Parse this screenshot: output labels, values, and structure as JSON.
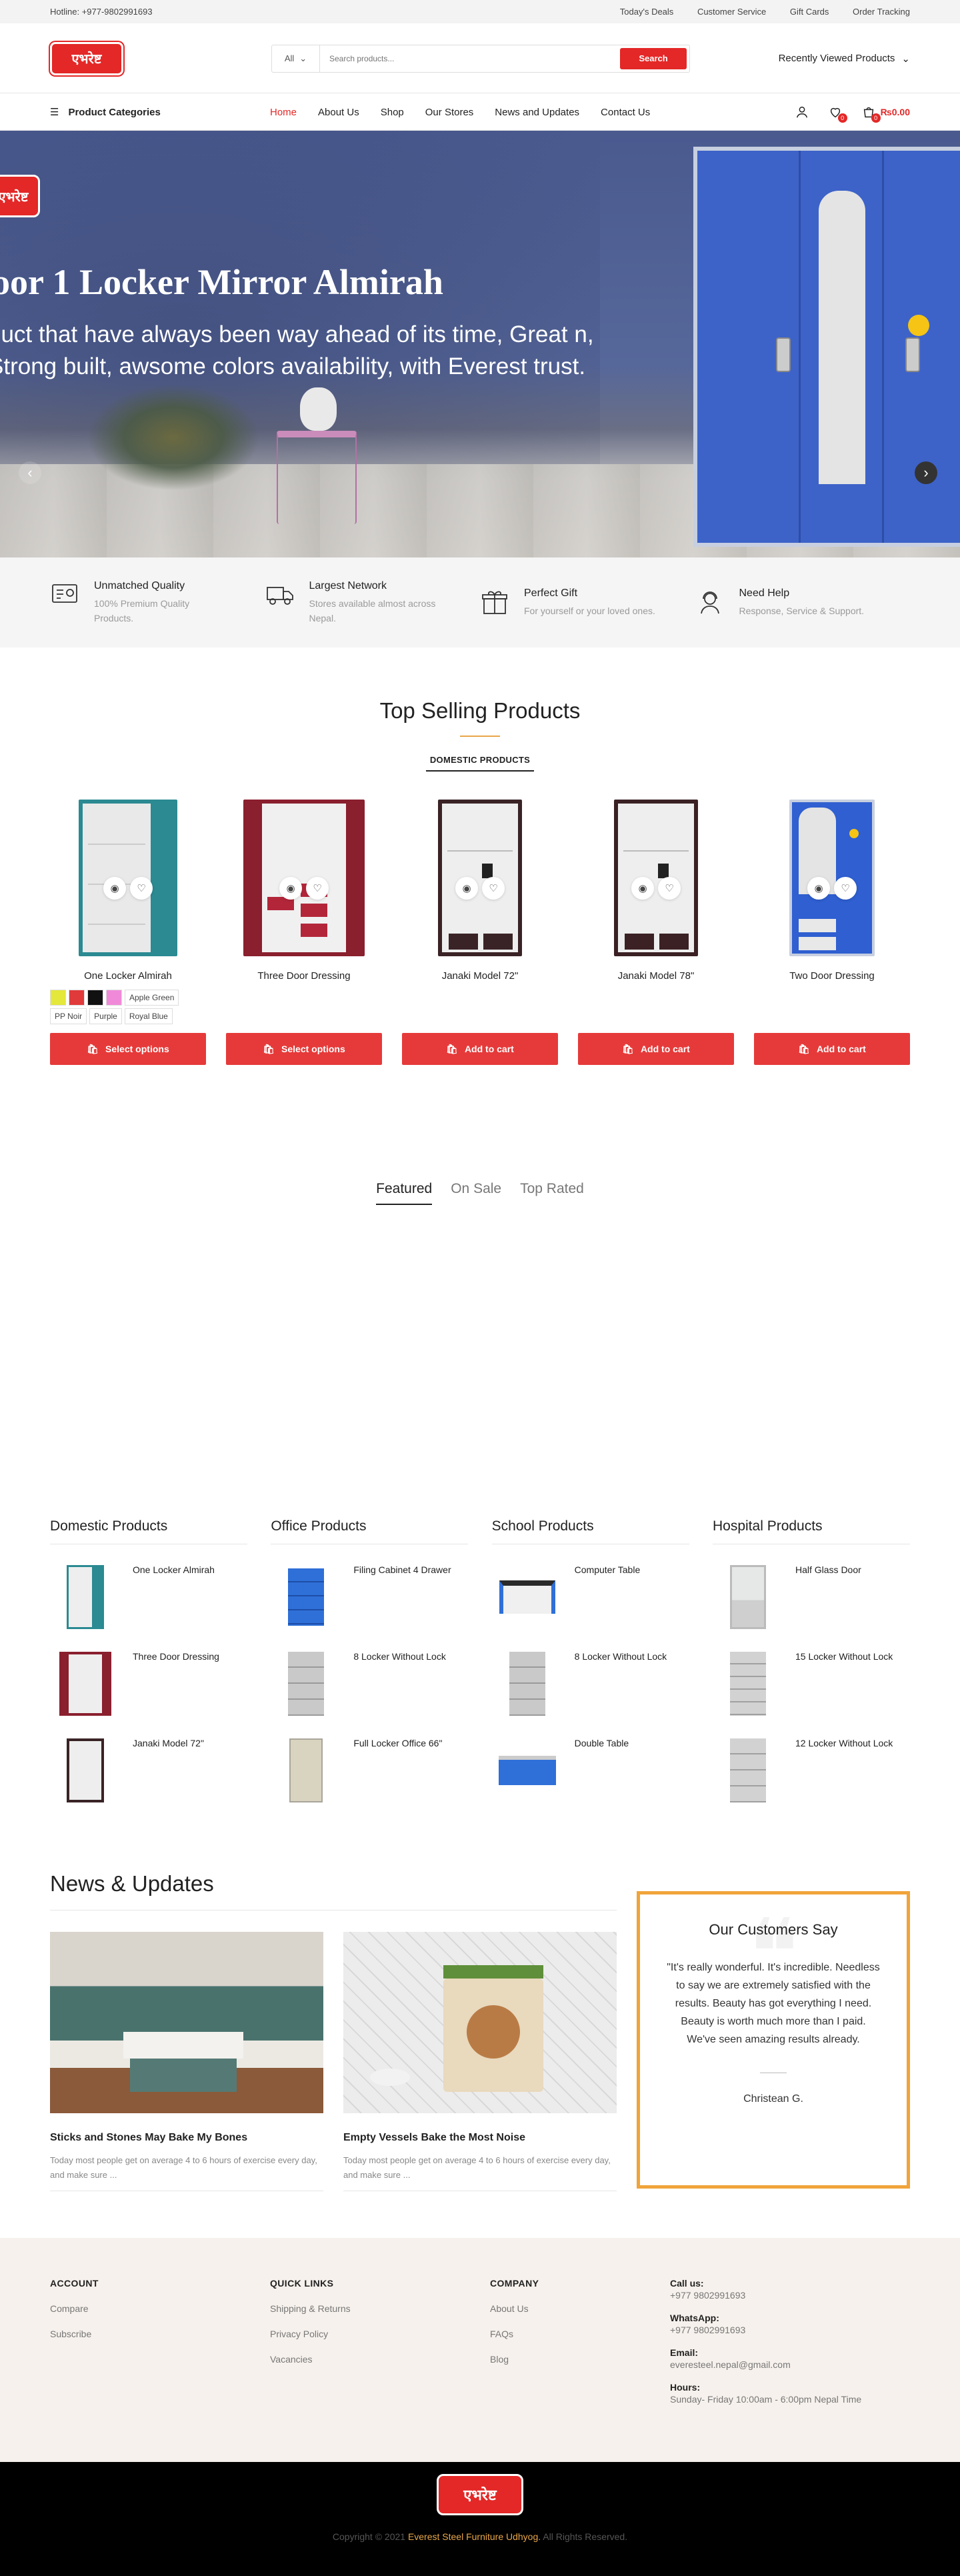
{
  "topbar": {
    "hotline": "Hotline: +977-9802991693",
    "links": [
      "Today's Deals",
      "Customer Service",
      "Gift Cards",
      "Order Tracking"
    ]
  },
  "header": {
    "logo_text": "एभरेष्ट",
    "search_category": "All",
    "search_placeholder": "Search products...",
    "search_button": "Search",
    "recently_viewed": "Recently Viewed Products"
  },
  "nav": {
    "categories_label": "Product Categories",
    "menu": [
      "Home",
      "About Us",
      "Shop",
      "Our Stores",
      "News and Updates",
      "Contact Us"
    ],
    "active_index": 0,
    "wishlist_count": "0",
    "cart_count": "0",
    "cart_total": "₨0.00"
  },
  "hero": {
    "logo_text": "एभरेष्ट",
    "title": "oor 1 Locker Mirror Almirah",
    "subtitle": "duct that have always been way ahead of its time, Great n, Strong built, awsome colors availability, with Everest trust."
  },
  "features": [
    {
      "icon": "quality-icon",
      "title": "Unmatched Quality",
      "text": "100% Premium Quality Products."
    },
    {
      "icon": "truck-icon",
      "title": "Largest Network",
      "text": "Stores available almost across Nepal."
    },
    {
      "icon": "gift-icon",
      "title": "Perfect Gift",
      "text": "For yourself or your loved ones."
    },
    {
      "icon": "support-icon",
      "title": "Need Help",
      "text": "Response, Service & Support."
    }
  ],
  "top_selling": {
    "title": "Top Selling Products",
    "tab": "DOMESTIC PRODUCTS",
    "products": [
      {
        "name": "One Locker Almirah",
        "button": "Select options",
        "color": "#2b8a92"
      },
      {
        "name": "Three Door Dressing",
        "button": "Select options",
        "color": "#8a1f2e"
      },
      {
        "name": "Janaki Model 72\"",
        "button": "Add to cart",
        "color": "#3a2326"
      },
      {
        "name": "Janaki Model 78\"",
        "button": "Add to cart",
        "color": "#3b2124"
      },
      {
        "name": "Two Door Dressing",
        "button": "Add to cart",
        "color": "#2f5fd0"
      }
    ],
    "swatches": [
      "#e4e83a",
      "#e03a3a",
      "#111111",
      "#f08ad8"
    ],
    "swatch_labels": [
      "Apple Green",
      "PP Noir",
      "Purple",
      "Royal Blue"
    ]
  },
  "featured_tabs": [
    "Featured",
    "On Sale",
    "Top Rated"
  ],
  "categories": [
    {
      "title": "Domestic Products",
      "items": [
        "One Locker Almirah",
        "Three Door Dressing",
        "Janaki Model 72\""
      ]
    },
    {
      "title": "Office Products",
      "items": [
        "Filing Cabinet 4 Drawer",
        "8 Locker Without Lock",
        "Full Locker Office 66\""
      ]
    },
    {
      "title": "School Products",
      "items": [
        "Computer Table",
        "8 Locker Without Lock",
        "Double Table"
      ]
    },
    {
      "title": "Hospital Products",
      "items": [
        "Half Glass Door",
        "15 Locker Without Lock",
        "12 Locker Without Lock"
      ]
    }
  ],
  "news": {
    "title": "News & Updates",
    "posts": [
      {
        "title": "Sticks and Stones May Bake My Bones",
        "excerpt": "Today most people get on average 4 to 6 hours of exercise every day, and make sure ..."
      },
      {
        "title": "Empty Vessels Bake the Most Noise",
        "excerpt": "Today most people get on average 4 to 6 hours of exercise every day, and make sure ..."
      }
    ]
  },
  "testimonial": {
    "title": "Our Customers Say",
    "text": "\"It's really wonderful. It's incredible. Needless to say we are extremely satisfied with the results. Beauty has got everything I need. Beauty is worth much more than I paid. We've seen amazing results already.",
    "author": "Christean G."
  },
  "footer": {
    "account": {
      "title": "ACCOUNT",
      "links": [
        "Compare",
        "Subscribe"
      ]
    },
    "quick": {
      "title": "QUICK LINKS",
      "links": [
        "Shipping & Returns",
        "Privacy Policy",
        "Vacancies"
      ]
    },
    "company": {
      "title": "COMPANY",
      "links": [
        "About Us",
        "FAQs",
        "Blog"
      ]
    },
    "contact": {
      "call_label": "Call us:",
      "call": "+977 9802991693",
      "whatsapp_label": "WhatsApp:",
      "whatsapp": "+977 9802991693",
      "email_label": "Email:",
      "email": "everesteel.nepal@gmail.com",
      "hours_label": "Hours:",
      "hours": "Sunday- Friday 10:00am - 6:00pm Nepal Time"
    },
    "logo_text": "एभरेष्ट",
    "copyright_pre": "Copyright © 2021",
    "copyright_brand": "Everest Steel Furniture Udhyog.",
    "copyright_post": "All Rights Reserved."
  }
}
